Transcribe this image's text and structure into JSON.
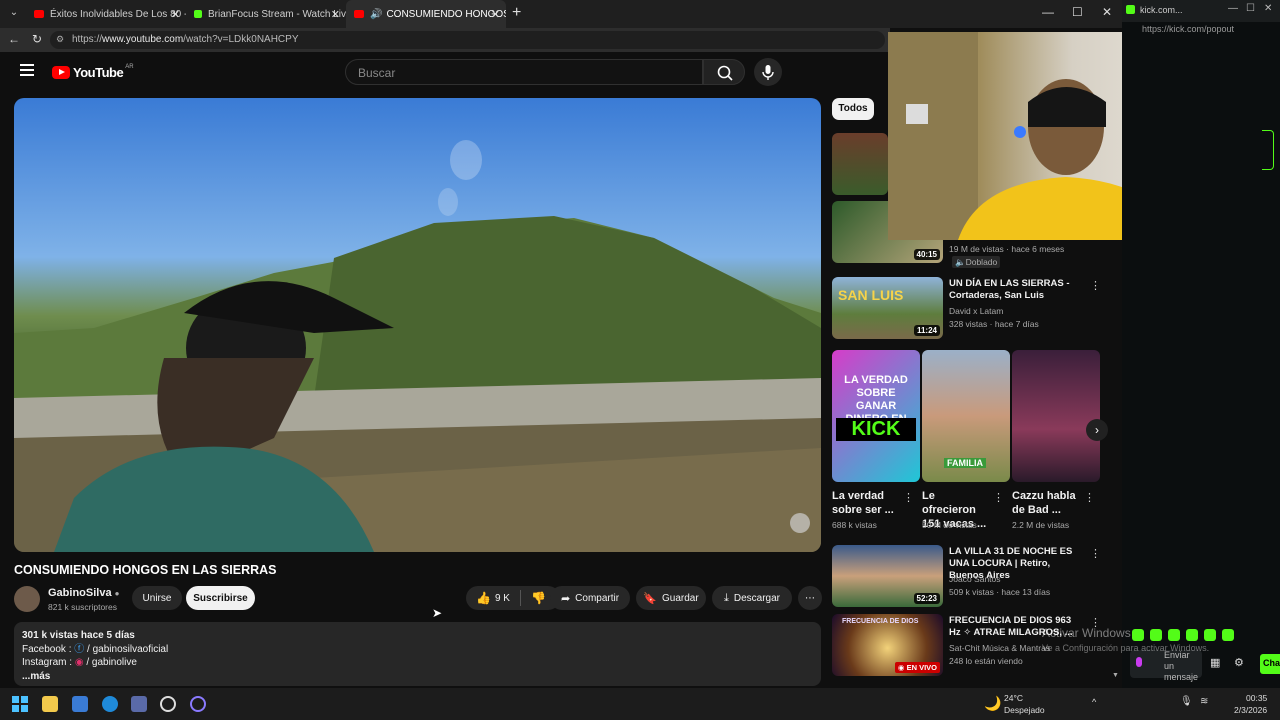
{
  "browser": {
    "tabs": [
      {
        "label": "Éxitos Inolvidables De Los 80 - Los"
      },
      {
        "label": "BrianFocus Stream - Watch Live on"
      },
      {
        "label": "CONSUMIENDO HONGOS EN"
      }
    ],
    "url_prefix": "https://",
    "url_host": "www.youtube.com",
    "url_path": "/watch?v=LDkk0NAHCPY",
    "second_window_url": "https://kick.com/popout",
    "second_window_title": "kick.com..."
  },
  "youtube": {
    "logo_text": "YouTube",
    "country_code": "AR",
    "search_placeholder": "Buscar",
    "video": {
      "title": "CONSUMIENDO HONGOS EN LAS SIERRAS",
      "channel": "GabinoSilva",
      "subscribers": "821 k suscriptores",
      "join_label": "Unirse",
      "subscribe_label": "Suscribirse",
      "likes": "9 K",
      "share_label": "Compartir",
      "save_label": "Guardar",
      "download_label": "Descargar"
    },
    "description": {
      "stats": "301 k vistas  hace 5 días",
      "facebook_label": "Facebook :",
      "facebook_value": "/ gabinosilvaoficial",
      "instagram_label": "Instagram :",
      "instagram_value": "/ gabinolive",
      "more": "...más"
    },
    "chip_all": "Todos",
    "related": [
      {
        "meta1": "19 M de vistas · hace 6 meses",
        "badge": "Doblado",
        "duration": "40:15"
      },
      {
        "title": "UN DÍA EN LAS SIERRAS - Cortaderas, San Luis",
        "channel": "David x Latam",
        "meta": "328 vistas · hace 7 días",
        "duration": "11:24",
        "thumb_text": "SAN LUIS"
      },
      {
        "title": "LA VILLA 31 DE NOCHE ES UNA LOCURA | Retiro, Buenos Aires",
        "channel": "Joaco Santos",
        "meta": "509 k vistas · hace 13 días",
        "duration": "52:23"
      },
      {
        "title": "FRECUENCIA DE DIOS 963 Hz ✧ ATRAE MILAGROS, ...",
        "channel": "Sat-Chit Música & Mantras",
        "meta": "248 lo están viendo",
        "live": "EN VIVO",
        "thumb_text": "FRECUENCIA DE DIOS"
      }
    ],
    "shorts": [
      {
        "title": "La verdad sobre ser ...",
        "views": "688 k vistas",
        "thumb_text": "LA VERDAD SOBRE GANAR DINERO EN",
        "thumb_text2": "KICK"
      },
      {
        "title": "Le ofrecieron 151 vacas ...",
        "views": "50 M de vistas",
        "thumb_text": "FAMILIA"
      },
      {
        "title": "Cazzu habla de Bad ...",
        "views": "2.2 M de vistas"
      }
    ]
  },
  "overlay": {
    "activate_title": "Activar Windows",
    "activate_sub": "Ve a Configuración para activar Windows."
  },
  "kick": {
    "send_label": "Enviar un mensaje",
    "chat_label": "Cha"
  },
  "taskbar": {
    "temp": "24°C",
    "weather": "Despejado",
    "time": "00:35",
    "date": "2/3/2026"
  },
  "colors": {
    "yt_red": "#ff0000",
    "kick_green": "#53fc18"
  }
}
